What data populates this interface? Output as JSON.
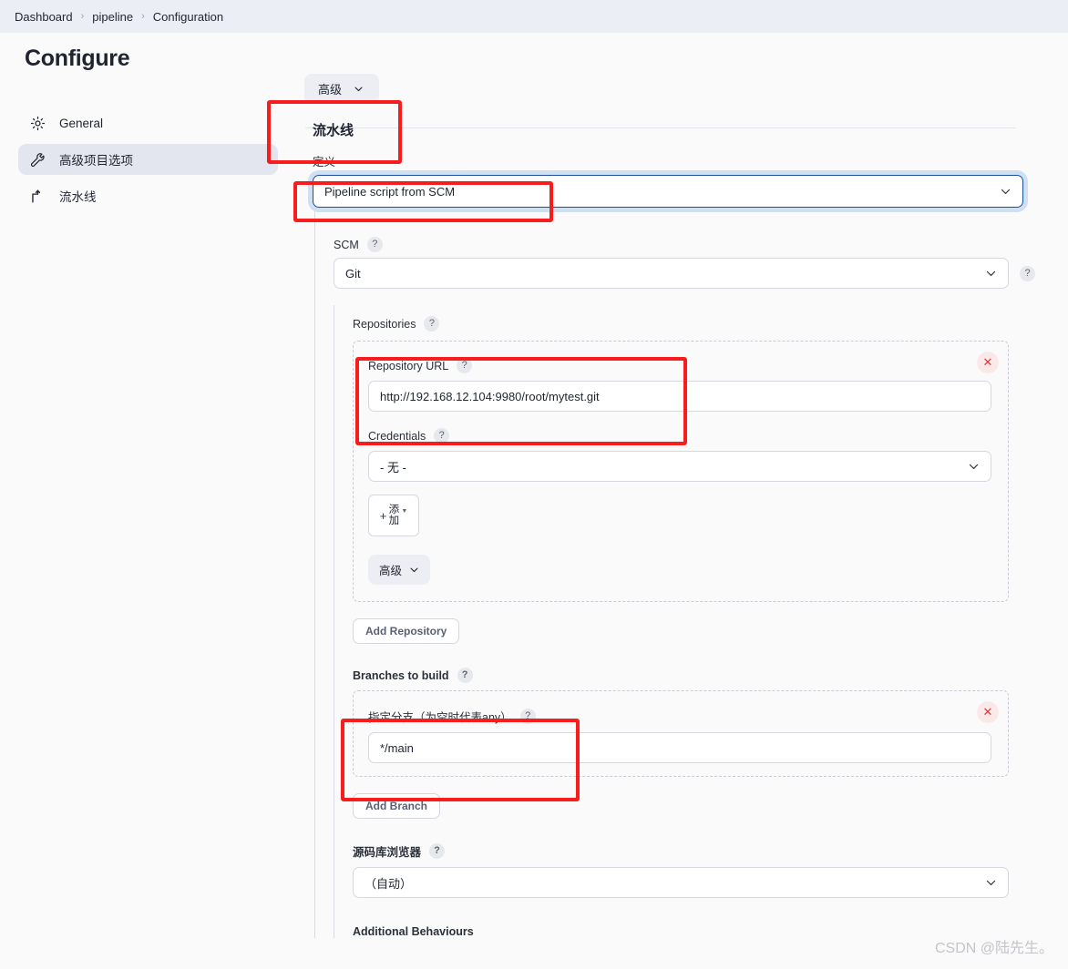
{
  "breadcrumb": {
    "items": [
      "Dashboard",
      "pipeline",
      "Configuration"
    ],
    "separator": "›"
  },
  "header": {
    "title": "Configure",
    "advanced_pill_label": "高级",
    "caret_icon": "chevron-down-icon"
  },
  "sidebar": {
    "items": [
      {
        "label": "General",
        "icon": "gear-icon",
        "active": false
      },
      {
        "label": "高级项目选项",
        "icon": "wrench-icon",
        "active": true
      },
      {
        "label": "流水线",
        "icon": "pipeline-icon",
        "active": false
      }
    ]
  },
  "main": {
    "section_title": "流水线",
    "definition": {
      "label": "定义",
      "value": "Pipeline script from SCM",
      "focused": true
    },
    "scm": {
      "label": "SCM",
      "help": "?",
      "value": "Git",
      "trailing_help": "?"
    },
    "repositories": {
      "label": "Repositories",
      "help": "?",
      "repository_url": {
        "label": "Repository URL",
        "help": "?",
        "value": "http://192.168.12.104:9980/root/mytest.git"
      },
      "credentials": {
        "label": "Credentials",
        "help": "?",
        "value": "- 无 -"
      },
      "add_button": {
        "plus": "+",
        "label": "添加",
        "caret_icon": "caret-down-icon"
      },
      "advanced_pill_label": "高级",
      "remove_icon": "close-icon"
    },
    "add_repository_label": "Add Repository",
    "branches": {
      "label": "Branches to build",
      "help": "?",
      "specifier": {
        "label": "指定分支（为空时代表any）",
        "help": "?",
        "value": "*/main"
      },
      "remove_icon": "close-icon"
    },
    "add_branch_label": "Add Branch",
    "repository_browser": {
      "label": "源码库浏览器",
      "help": "?",
      "value": "（自动）"
    },
    "additional_behaviours_label": "Additional Behaviours"
  },
  "watermark": "CSDN @陆先生。",
  "colors": {
    "annotation_red": "#f91c1c",
    "focus_blue": "#1f4f9c",
    "sidebar_active": "#e4e6ef"
  }
}
